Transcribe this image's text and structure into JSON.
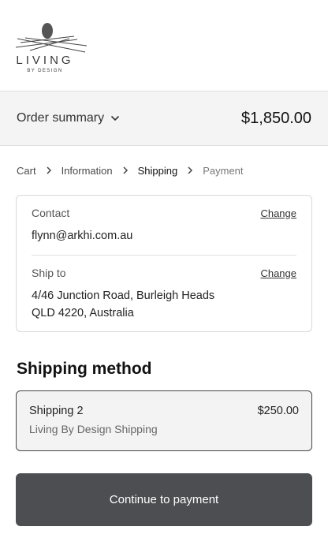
{
  "logo": {
    "word": "LIVING",
    "sub": "BY DESIGN"
  },
  "summary": {
    "toggle_label": "Order summary",
    "total": "$1,850.00"
  },
  "breadcrumb": [
    {
      "label": "Cart"
    },
    {
      "label": "Information"
    },
    {
      "label": "Shipping"
    },
    {
      "label": "Payment"
    }
  ],
  "review": {
    "contact": {
      "label": "Contact",
      "change": "Change",
      "value": "flynn@arkhi.com.au"
    },
    "ship_to": {
      "label": "Ship to",
      "change": "Change",
      "line1": "4/46 Junction Road, Burleigh Heads",
      "line2": "QLD 4220, Australia"
    }
  },
  "shipping_method": {
    "title": "Shipping method",
    "name": "Shipping 2",
    "price": "$250.00",
    "carrier": "Living By Design Shipping"
  },
  "continue_label": "Continue to payment",
  "colors": {
    "button_bg": "#4d4e52",
    "summary_bg": "#f4f4f4"
  },
  "icons": [
    "logo-egg-icon",
    "chevron-down-icon",
    "chevron-right-icon"
  ]
}
